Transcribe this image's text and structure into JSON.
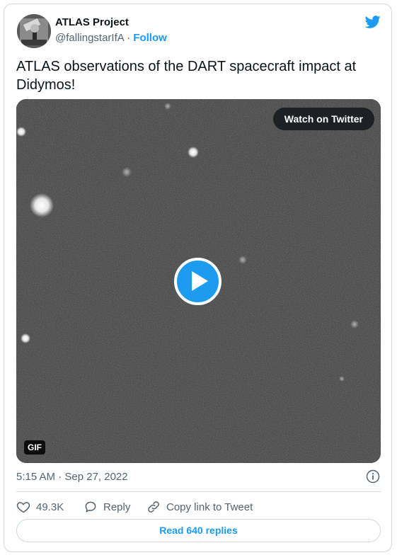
{
  "author": {
    "name": "ATLAS Project",
    "handle": "@fallingstarIfA",
    "separator": "·",
    "follow_label": "Follow"
  },
  "tweet": {
    "text": "ATLAS observations of the DART spacecraft impact at Didymos!"
  },
  "media": {
    "watch_label": "Watch on Twitter",
    "gif_badge": "GIF"
  },
  "timestamp": "5:15 AM · Sep 27, 2022",
  "actions": {
    "like_count": "49.3K",
    "reply_label": "Reply",
    "copy_link_label": "Copy link to Tweet"
  },
  "read_replies_label": "Read 640 replies",
  "colors": {
    "accent": "#1d9bf0",
    "text": "#0f1419",
    "muted": "#536471",
    "border": "#cfd9de"
  }
}
